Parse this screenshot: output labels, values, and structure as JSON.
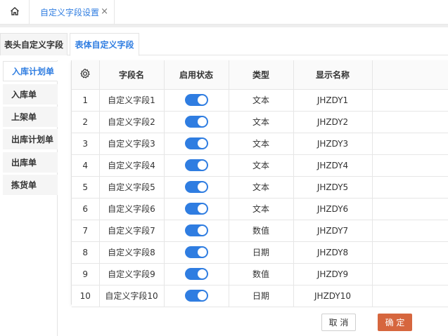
{
  "top_tabs": {
    "home_icon": "home-icon",
    "active_tab_label": "自定义字段设置",
    "close_icon": "close-icon",
    "close_glyph": "×"
  },
  "sub_tabs": [
    "表头自定义字段",
    "表体自定义字段"
  ],
  "left_nav": [
    "入库计划单",
    "入库单",
    "上架单",
    "出库计划单",
    "出库单",
    "拣货单"
  ],
  "table": {
    "settings_icon": "gear-icon",
    "headers": [
      "字段名",
      "启用状态",
      "类型",
      "显示名称"
    ],
    "rows": [
      {
        "index": "1",
        "name": "自定义字段1",
        "enabled": true,
        "type": "文本",
        "display": "JHZDY1"
      },
      {
        "index": "2",
        "name": "自定义字段2",
        "enabled": true,
        "type": "文本",
        "display": "JHZDY2"
      },
      {
        "index": "3",
        "name": "自定义字段3",
        "enabled": true,
        "type": "文本",
        "display": "JHZDY3"
      },
      {
        "index": "4",
        "name": "自定义字段4",
        "enabled": true,
        "type": "文本",
        "display": "JHZDY4"
      },
      {
        "index": "5",
        "name": "自定义字段5",
        "enabled": true,
        "type": "文本",
        "display": "JHZDY5"
      },
      {
        "index": "6",
        "name": "自定义字段6",
        "enabled": true,
        "type": "文本",
        "display": "JHZDY6"
      },
      {
        "index": "7",
        "name": "自定义字段7",
        "enabled": true,
        "type": "数值",
        "display": "JHZDY7"
      },
      {
        "index": "8",
        "name": "自定义字段8",
        "enabled": true,
        "type": "日期",
        "display": "JHZDY8"
      },
      {
        "index": "9",
        "name": "自定义字段9",
        "enabled": true,
        "type": "数值",
        "display": "JHZDY9"
      },
      {
        "index": "10",
        "name": "自定义字段10",
        "enabled": true,
        "type": "日期",
        "display": "JHZDY10"
      }
    ]
  },
  "buttons": {
    "cancel": "取 消",
    "ok": "确 定"
  },
  "colors": {
    "accent": "#2f7de1",
    "confirm": "#d6663e"
  }
}
